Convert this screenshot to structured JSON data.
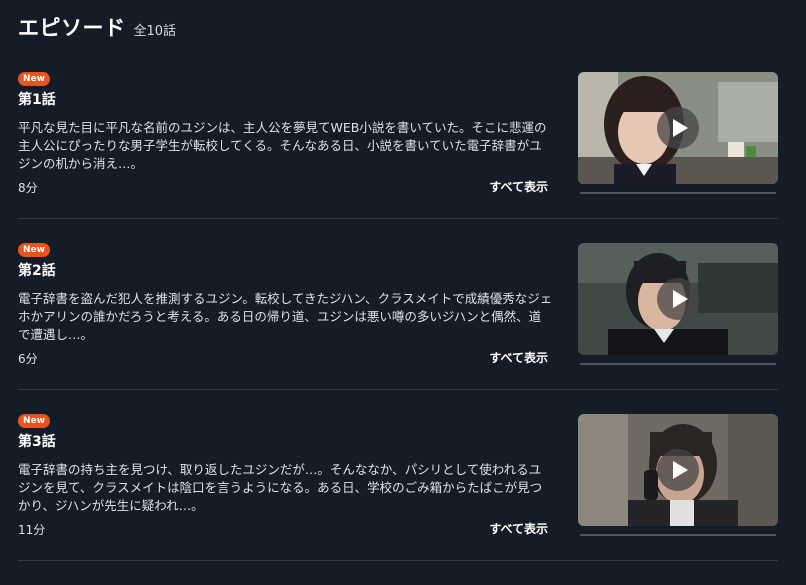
{
  "header": {
    "title": "エピソード",
    "count": "全10話"
  },
  "episodes": [
    {
      "badge": "New",
      "title": "第1話",
      "description": "平凡な見た目に平凡な名前のユジンは、主人公を夢見てWEB小説を書いていた。そこに悲運の主人公にぴったりな男子学生が転校してくる。そんなある日、小説を書いていた電子辞書がユジンの机から消え…。",
      "duration": "8分",
      "more": "すべて表示",
      "progress": 0
    },
    {
      "badge": "New",
      "title": "第2話",
      "description": "電子辞書を盗んだ犯人を推測するユジン。転校してきたジハン、クラスメイトで成績優秀なジェホかアリンの誰かだろうと考える。ある日の帰り道、ユジンは悪い噂の多いジハンと偶然、道で遭遇し…。",
      "duration": "6分",
      "more": "すべて表示",
      "progress": 0
    },
    {
      "badge": "New",
      "title": "第3話",
      "description": "電子辞書の持ち主を見つけ、取り返したユジンだが…。そんななか、パシリとして使われるユジンを見て、クラスメイトは陰口を言うようになる。ある日、学校のごみ箱からたばこが見つかり、ジハンが先生に疑われ…。",
      "duration": "11分",
      "more": "すべて表示",
      "progress": 0
    }
  ]
}
